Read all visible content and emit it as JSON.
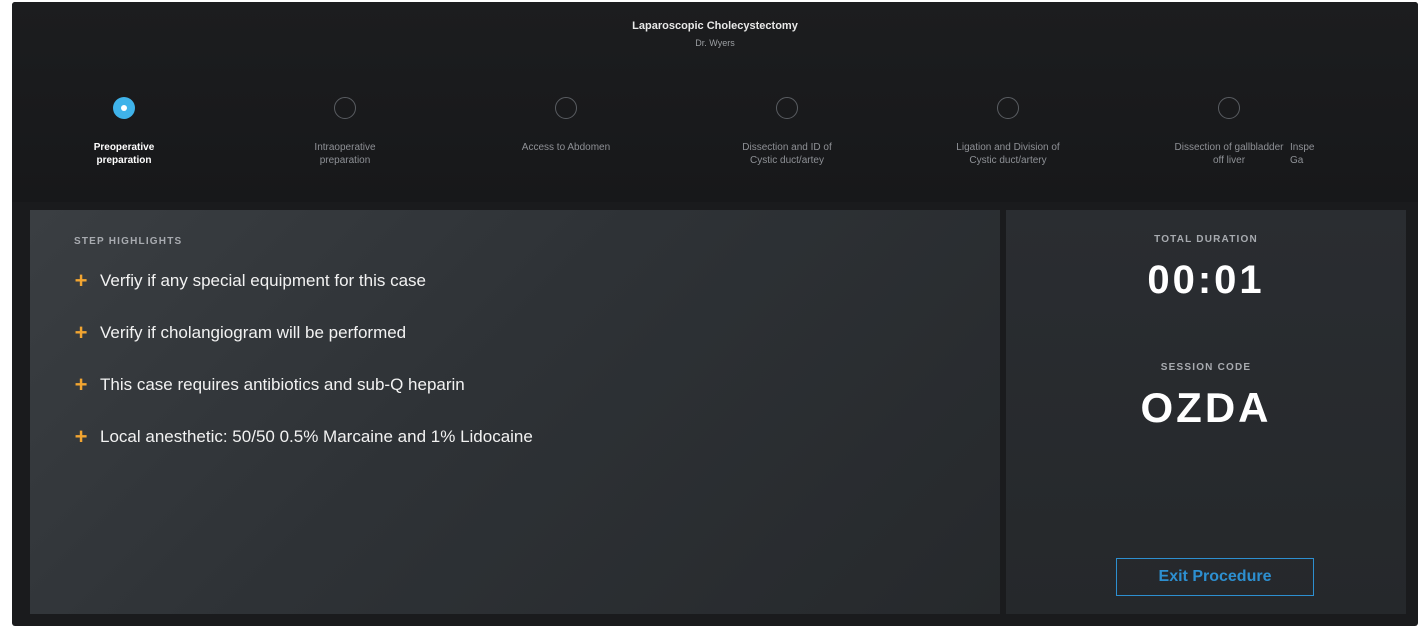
{
  "procedure": {
    "title": "Laparoscopic Cholecystectomy",
    "doctor": "Dr. Wyers"
  },
  "steps": [
    {
      "label": "Preoperative\npreparation",
      "state": "active"
    },
    {
      "label": "Intraoperative\npreparation",
      "state": "pending"
    },
    {
      "label": "Access to Abdomen",
      "state": "pending"
    },
    {
      "label": "Dissection and ID of\nCystic duct/artey",
      "state": "pending"
    },
    {
      "label": "Ligation and Division of\nCystic duct/artery",
      "state": "pending"
    },
    {
      "label": "Dissection of gallbladder\noff liver",
      "state": "pending"
    },
    {
      "label": "Inspe\nGa",
      "state": "pending"
    }
  ],
  "highlights": {
    "title": "STEP HIGHLIGHTS",
    "icon": "plus-icon",
    "items": [
      "Verfiy if any special equipment for this case",
      "Verify if cholangiogram will be performed",
      "This case requires antibiotics and sub-Q heparin",
      "Local anesthetic: 50/50 0.5% Marcaine and 1% Lidocaine"
    ]
  },
  "session": {
    "duration_label": "TOTAL DURATION",
    "duration_value": "00:01",
    "code_label": "SESSION CODE",
    "code_value": "OZDA"
  },
  "actions": {
    "exit_label": "Exit Procedure"
  },
  "colors": {
    "accent": "#3fb3ea",
    "plus": "#f2a531",
    "exit": "#2d8fd0",
    "background": "#1a1b1d"
  }
}
